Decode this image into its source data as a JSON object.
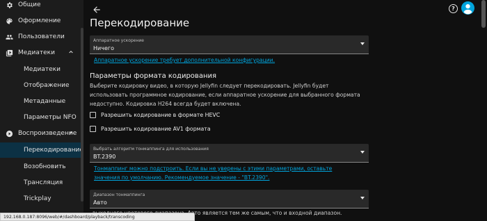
{
  "sidebar": {
    "items": [
      {
        "label": "Общие",
        "icon": "gear-icon"
      },
      {
        "label": "Оформление",
        "icon": "palette-icon"
      },
      {
        "label": "Пользователи",
        "icon": "people-icon"
      },
      {
        "label": "Медиатеки",
        "icon": "library-icon",
        "expanded": true
      },
      {
        "label": "Медиатеки"
      },
      {
        "label": "Отображение"
      },
      {
        "label": "Метаданные"
      },
      {
        "label": "Параметры NFO"
      },
      {
        "label": "Воспроизведение",
        "icon": "play-circle-icon",
        "expanded": true
      },
      {
        "label": "Перекодирование",
        "active": true
      },
      {
        "label": "Возобновить"
      },
      {
        "label": "Трансляция"
      },
      {
        "label": "Trickplay"
      }
    ]
  },
  "header": {
    "title": "Перекодирование"
  },
  "hw_accel": {
    "label": "Аппаратное ускорение",
    "value": "Ничего",
    "config_link": "Аппаратное ускорение требует дополнительной конфигурации."
  },
  "formats": {
    "heading": "Параметры формата кодирования",
    "description": "Выберите кодировку видео, в которую Jellyfin следует перекодировать. Jellyfin будет использовать программное кодирование, если аппаратное ускорение для выбранного формата недоступно. Кодировка H264 всегда будет включена.",
    "hevc_label": "Разрешить кодирование в формате HEVC",
    "av1_label": "Разрешить кодирование AV1 формата"
  },
  "tonemap_algorithm": {
    "label": "Выбрать алгоритм тонмаппинга для использования",
    "value": "BT.2390",
    "help": "Тонмаппинг можно подстроить. Если вы не уверены с этими параметрами, оставьте значения по умолчанию. Рекомендуемое значение - \"BT.2390\"."
  },
  "tonemap_range": {
    "label": "Диапазон тонмаппинга",
    "value": "Авто",
    "desc_visible": "выходного цветового диапазона. Авто является тем же самым, что и входной диапазон."
  },
  "status_bar": {
    "url": "192.168.0.187:8096/web/#/dashboard/playback/transcoding"
  },
  "colors": {
    "accent": "#00a4dc",
    "active_bg": "#0c3144",
    "background": "#101010",
    "sidebar_bg": "#1c1c1c"
  }
}
